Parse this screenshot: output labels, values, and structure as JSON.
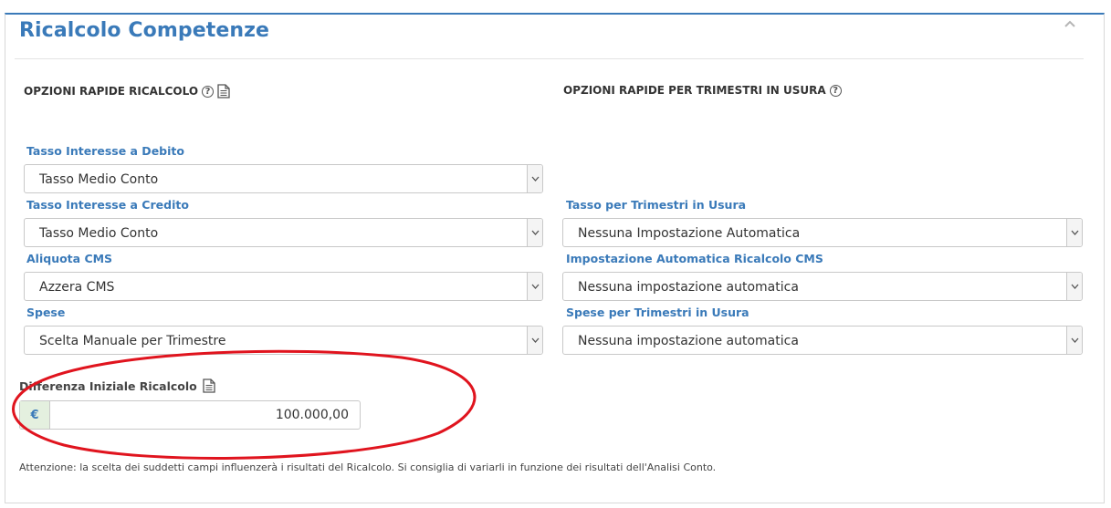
{
  "panel": {
    "title": "Ricalcolo Competenze",
    "collapse_icon": "chevron-up-icon"
  },
  "left_section": {
    "heading": "OPZIONI RAPIDE RICALCOLO",
    "icons": [
      "question-circle-icon",
      "document-icon"
    ],
    "fields": [
      {
        "label": "Tasso Interesse a Debito",
        "value": "Tasso Medio Conto"
      },
      {
        "label": "Tasso Interesse a Credito",
        "value": "Tasso Medio Conto"
      },
      {
        "label": "Aliquota CMS",
        "value": "Azzera CMS"
      },
      {
        "label": "Spese",
        "value": "Scelta Manuale per Trimestre"
      }
    ]
  },
  "right_section": {
    "heading": "OPZIONI RAPIDE PER TRIMESTRI IN USURA",
    "icons": [
      "question-circle-icon"
    ],
    "fields": [
      {
        "label": "Tasso per Trimestri in Usura",
        "value": "Nessuna Impostazione Automatica"
      },
      {
        "label": "Impostazione Automatica Ricalcolo CMS",
        "value": "Nessuna impostazione automatica"
      },
      {
        "label": "Spese per Trimestri in Usura",
        "value": "Nessuna impostazione automatica"
      }
    ]
  },
  "initial_difference": {
    "label": "Differenza Iniziale Ricalcolo",
    "currency": "€",
    "value": "100.000,00"
  },
  "note": "Attenzione: la scelta dei suddetti campi influenzerà i risultati del Ricalcolo. Si consiglia di variarli in funzione dei risultati dell'Analisi Conto.",
  "colors": {
    "accent": "#3a7ab9",
    "annotation": "#e0141e",
    "currency_bg": "#e4f0df"
  }
}
